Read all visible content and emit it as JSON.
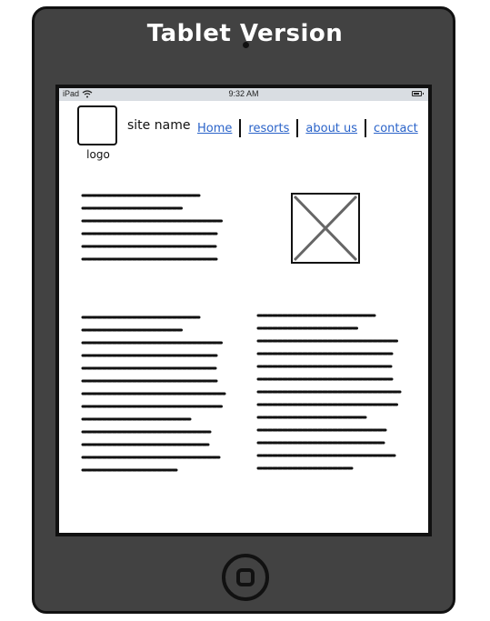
{
  "title": "Tablet Version",
  "status_bar": {
    "device": "iPad",
    "time": "9:32 AM",
    "wifi_icon": "wifi-icon",
    "battery_icon": "battery-icon"
  },
  "header": {
    "logo_label": "logo",
    "site_name": "site name",
    "nav": [
      "Home",
      "resorts",
      "about us",
      "contact"
    ]
  },
  "colors": {
    "frame": "#424242",
    "link": "#2a63c9",
    "statusbar": "#d9dde2"
  },
  "icons": {
    "image_placeholder": "image-placeholder-icon",
    "home_button": "home-button-icon"
  }
}
